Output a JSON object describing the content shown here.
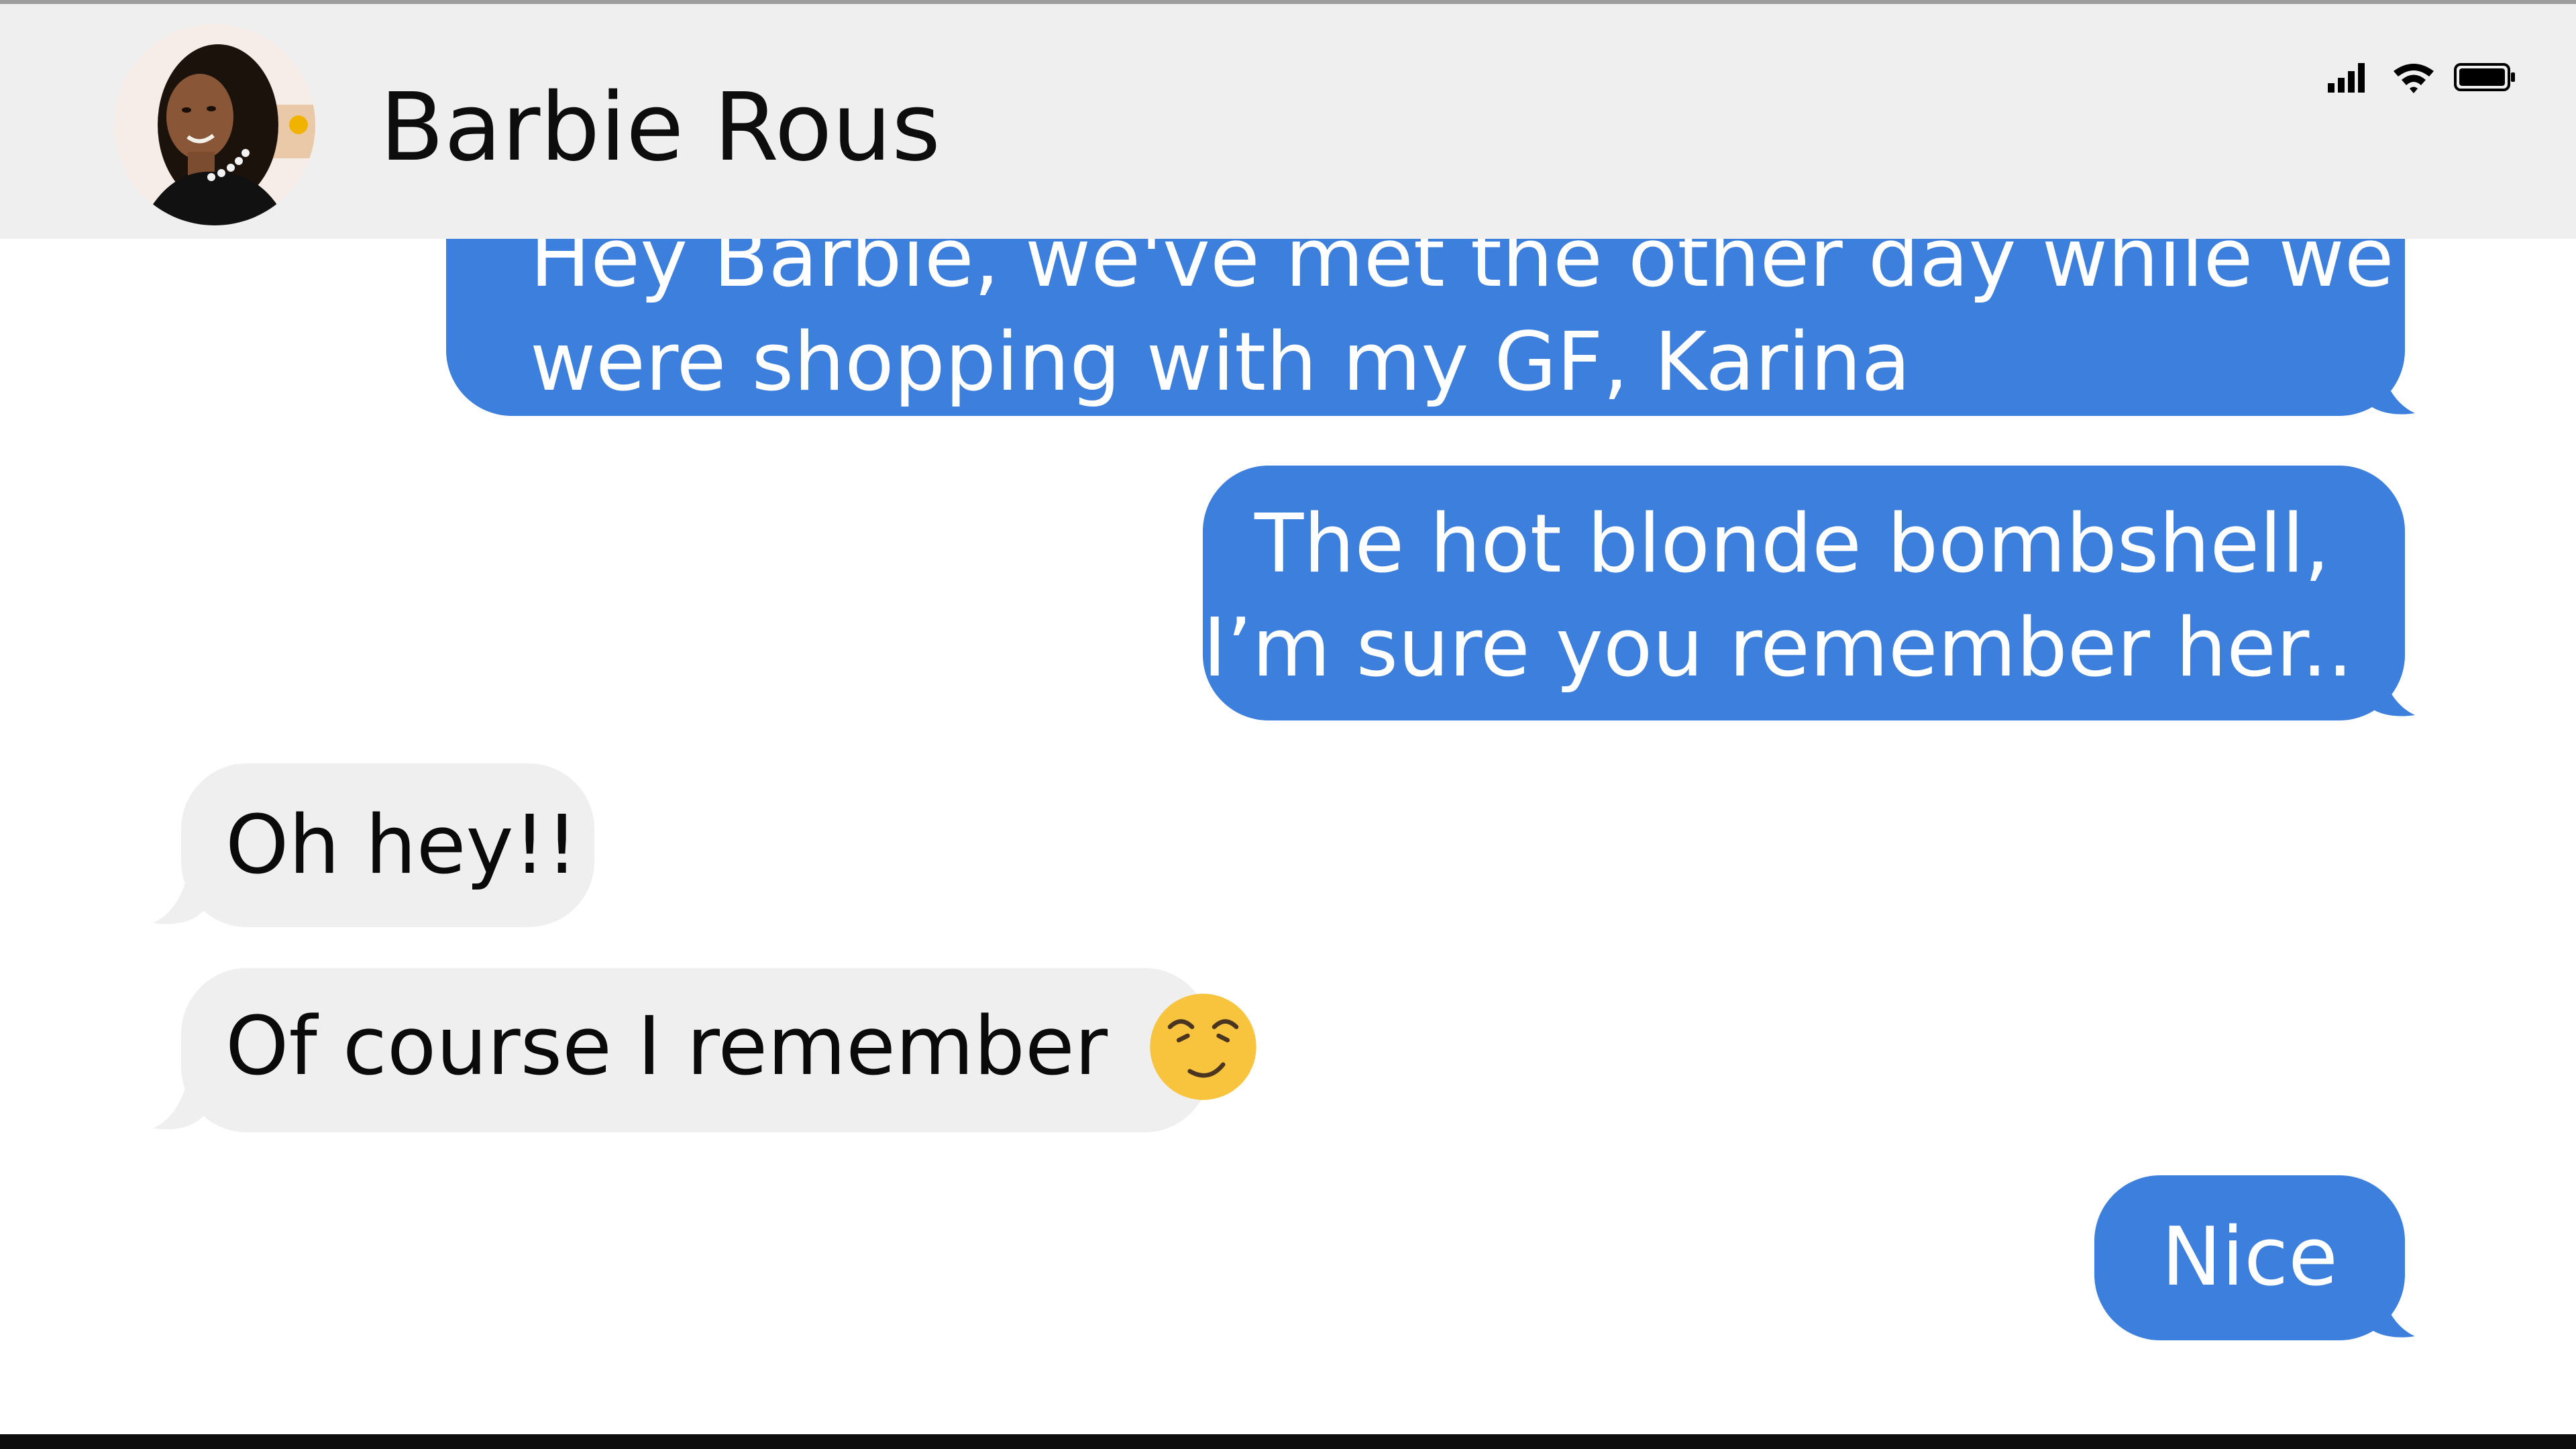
{
  "header": {
    "contact_name": "Barbie Rous",
    "avatar_icon": "profile-photo",
    "status_icons": [
      "signal-icon",
      "wifi-icon",
      "battery-icon"
    ]
  },
  "colors": {
    "outgoing_bubble": "#3d7fdc",
    "incoming_bubble": "#efefef",
    "header_background": "#efefef"
  },
  "messages": [
    {
      "direction": "outgoing",
      "lines": [
        "Hey Barbie, we've met the other day while we",
        "were shopping with my GF, Karina"
      ]
    },
    {
      "direction": "outgoing",
      "lines": [
        "The hot blonde bombshell,",
        "I’m sure you remember her..."
      ]
    },
    {
      "direction": "incoming",
      "lines": [
        "Oh hey!!"
      ]
    },
    {
      "direction": "incoming",
      "lines": [
        "Of course I remember"
      ],
      "emoji": "smirk-emoji"
    },
    {
      "direction": "outgoing",
      "lines": [
        "Nice"
      ]
    }
  ]
}
